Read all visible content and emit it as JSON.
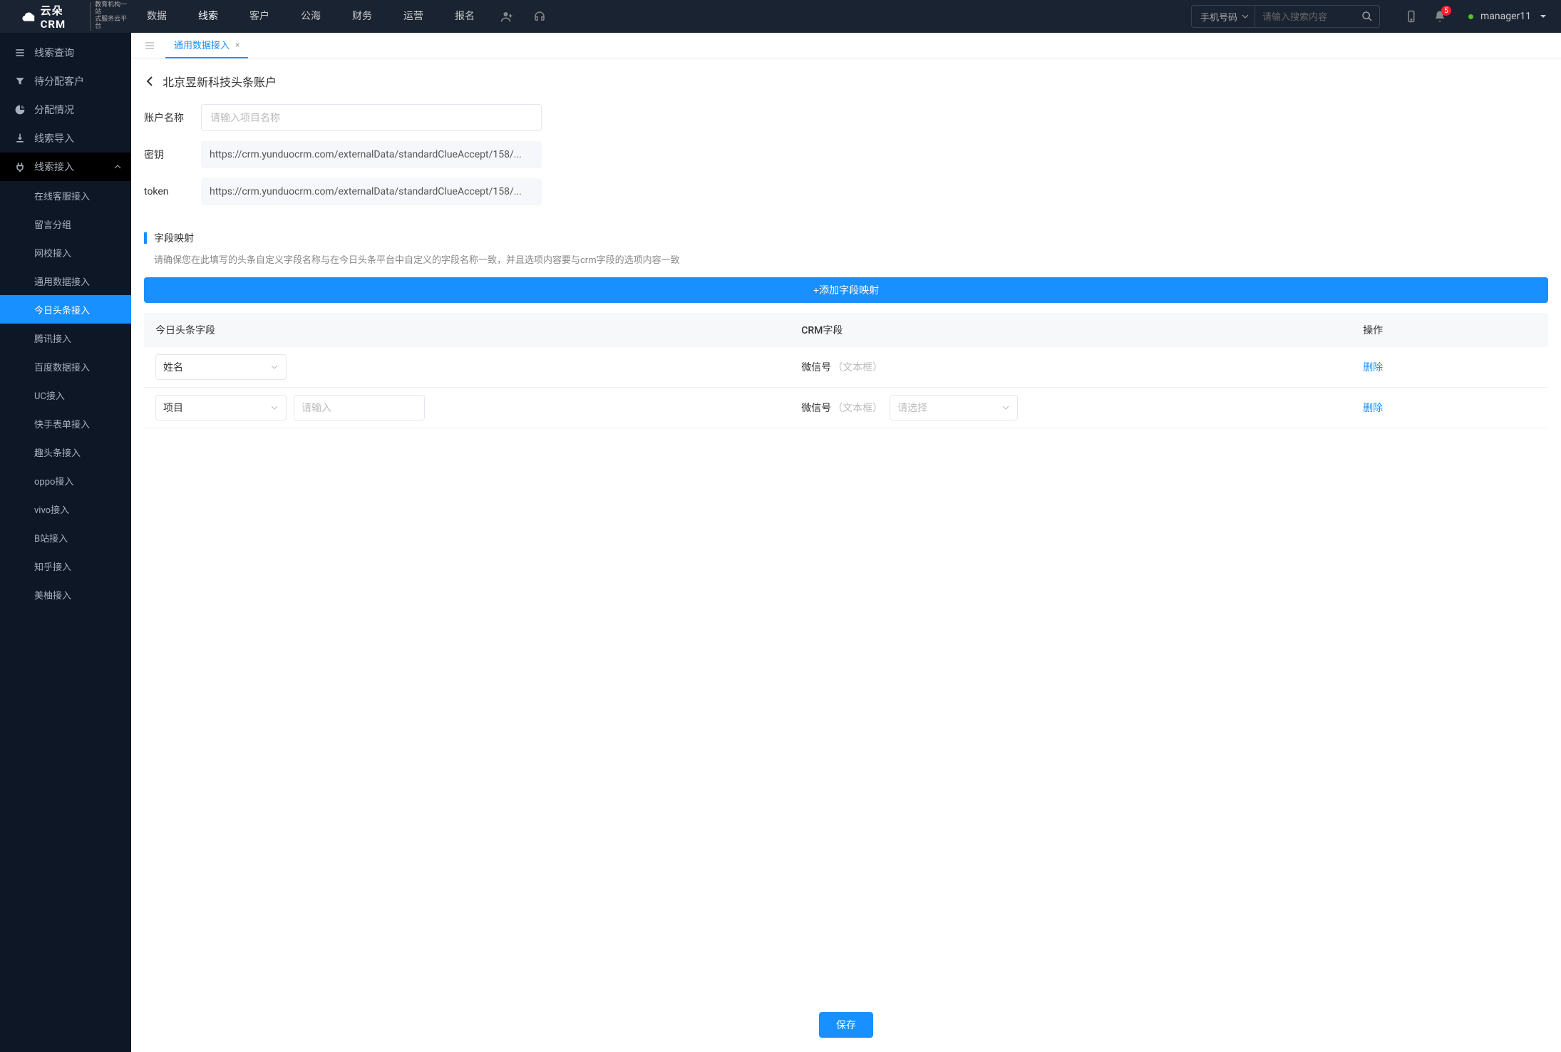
{
  "header": {
    "logo_text": "云朵CRM",
    "logo_sub_line1": "教育机构一站",
    "logo_sub_line2": "式服务云平台",
    "nav": [
      "数据",
      "线索",
      "客户",
      "公海",
      "财务",
      "运营",
      "报名"
    ],
    "nav_active_index": 1,
    "search_type": "手机号码",
    "search_placeholder": "请输入搜索内容",
    "notification_count": "5",
    "username": "manager11"
  },
  "sidebar": {
    "items": [
      {
        "icon": "list",
        "label": "线索查询"
      },
      {
        "icon": "filter",
        "label": "待分配客户"
      },
      {
        "icon": "pie",
        "label": "分配情况"
      },
      {
        "icon": "import",
        "label": "线索导入"
      },
      {
        "icon": "plug",
        "label": "线索接入",
        "expanded": true
      }
    ],
    "sub_items": [
      "在线客服接入",
      "留言分组",
      "网校接入",
      "通用数据接入",
      "今日头条接入",
      "腾讯接入",
      "百度数据接入",
      "UC接入",
      "快手表单接入",
      "趣头条接入",
      "oppo接入",
      "vivo接入",
      "B站接入",
      "知乎接入",
      "美柚接入"
    ],
    "sub_active_index": 4
  },
  "tab": {
    "label": "通用数据接入"
  },
  "page": {
    "title": "北京昱新科技头条账户",
    "form": {
      "account_label": "账户名称",
      "account_placeholder": "请输入项目名称",
      "secret_label": "密钥",
      "secret_value": "https://crm.yunduocrm.com/externalData/standardClueAccept/158/...",
      "token_label": "token",
      "token_value": "https://crm.yunduocrm.com/externalData/standardClueAccept/158/..."
    },
    "section": {
      "title": "字段映射",
      "desc": "请确保您在此填写的头条自定义字段名称与在今日头条平台中自定义的字段名称一致，并且选项内容要与crm字段的选项内容一致",
      "add_button": "+添加字段映射"
    },
    "table": {
      "headers": {
        "toutiao": "今日头条字段",
        "crm": "CRM字段",
        "action": "操作"
      },
      "rows": [
        {
          "field_select": "姓名",
          "extra_input": null,
          "crm_label": "微信号",
          "crm_hint": "（文本框）",
          "crm_select": null,
          "delete": "删除"
        },
        {
          "field_select": "项目",
          "extra_input": "",
          "extra_placeholder": "请输入",
          "crm_label": "微信号",
          "crm_hint": "（文本框）",
          "crm_select": "",
          "crm_select_placeholder": "请选择",
          "delete": "删除"
        }
      ]
    },
    "save_button": "保存"
  }
}
